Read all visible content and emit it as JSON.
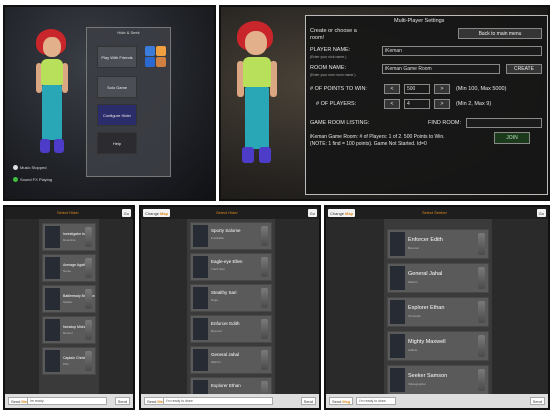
{
  "hide_and_seek": {
    "title": "Hide & Seek",
    "buttons": [
      "Play With Friends",
      "Solo Game",
      "Configure Hider",
      "Help"
    ],
    "status": [
      "Music Stopped",
      "Sound FX Playing"
    ],
    "colors": {
      "status_green": "#3fbf3f",
      "status_white": "#e0e0e0"
    }
  },
  "multiplayer": {
    "title": "Multi-Player Settings",
    "subtitle_line1": "Create or choose a",
    "subtitle_line2": "room!",
    "back_button": "Back to main menu",
    "player_name_label": "PLAYER NAME:",
    "player_name_hint": "(Enter your nick name.)",
    "player_name_value": "iKeman",
    "room_name_label": "ROOM NAME:",
    "room_name_hint": "(Enter your new room name.)",
    "room_name_value": "iKeman Game Room",
    "create_button": "CREATE",
    "points_label": "# OF POINTS TO WIN:",
    "points_value": "500",
    "points_range": "(Min 100, Max 5000)",
    "players_label": "# OF PLAYERS:",
    "players_value": "4",
    "players_range": "(Min 2, Max 9)",
    "decrement": "<",
    "increment": ">",
    "listing_label": "GAME ROOM LISTING:",
    "find_label": "FIND ROOM:",
    "room_entry_line1": "iKeman Game Room: # of Players: 1 of 2. 500 Points to Win.",
    "room_entry_line2": "(NOTE: 1 find = 100 points). Game Not Started. Id=0",
    "join_button": "JOIN"
  },
  "list_screens": [
    {
      "top_left": "",
      "top_left_accent": "",
      "title": "Select Hider",
      "top_right": "Go",
      "items": [
        {
          "name": "Investigator Isaiah",
          "sub": "Detective"
        },
        {
          "name": "Average Agatha",
          "sub": "Nurse"
        },
        {
          "name": "Battleready Bronson",
          "sub": "Soldier"
        },
        {
          "name": "Nonstop Michelle",
          "sub": "Runner"
        },
        {
          "name": "Captain Christine",
          "sub": "Pilot"
        }
      ],
      "bottom_left": "Send",
      "bottom_left_accent": "Msg",
      "bottom_input": "Im ready",
      "bottom_right": "Send"
    },
    {
      "top_left": "Change",
      "top_left_accent": "Map",
      "title": "Select Hider",
      "top_right": "Go",
      "items": [
        {
          "name": "Sporty Salome",
          "sub": "Footballer"
        },
        {
          "name": "Eagle-eye Ellen",
          "sub": "Track Star"
        },
        {
          "name": "Stealthy Sari",
          "sub": "Ninja"
        },
        {
          "name": "Enforcer Edith",
          "sub": "Bouncer"
        },
        {
          "name": "General Jahal",
          "sub": "Warrior"
        },
        {
          "name": "Explorer Ethan",
          "sub": ""
        }
      ],
      "bottom_left": "Send",
      "bottom_left_accent": "Msg",
      "bottom_input": "I'm ready to draw",
      "bottom_right": "Send"
    },
    {
      "top_left": "Change",
      "top_left_accent": "Map",
      "title": "Select Seeker",
      "top_right": "Go",
      "items": [
        {
          "name": "Enforcer Edith",
          "sub": "Bouncer"
        },
        {
          "name": "General Jahal",
          "sub": "Warrior"
        },
        {
          "name": "Explorer Ethan",
          "sub": "Chronicle"
        },
        {
          "name": "Mighty Maxwell",
          "sub": "Athlete"
        },
        {
          "name": "Seeker Samson",
          "sub": "Videographer"
        }
      ],
      "bottom_left": "Send",
      "bottom_left_accent": "Msg",
      "bottom_input": "I'm ready to draw",
      "bottom_right": "Send"
    }
  ]
}
